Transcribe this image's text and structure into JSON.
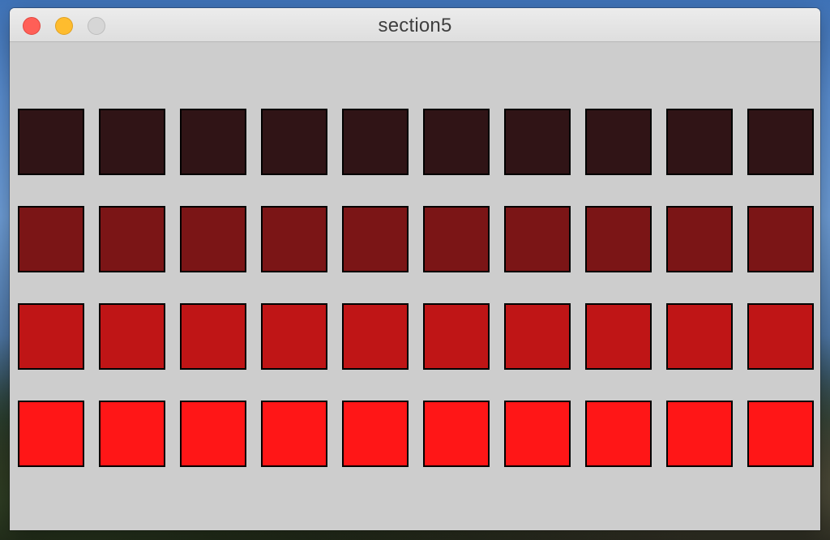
{
  "window": {
    "title": "section5",
    "controls": {
      "close": "close",
      "minimize": "minimize",
      "zoom": "zoom"
    }
  },
  "grid": {
    "rows": 4,
    "columns": 10,
    "row_colors": [
      "#301416",
      "#7b1516",
      "#bf1516",
      "#ff1617"
    ],
    "border_color": "#000000"
  }
}
